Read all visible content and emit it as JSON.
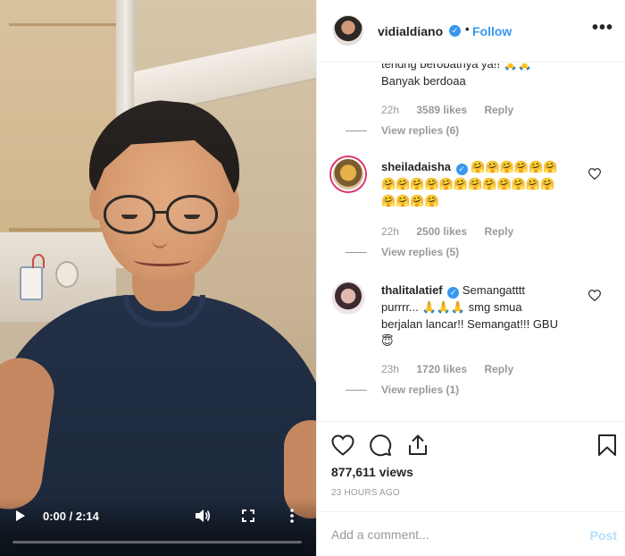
{
  "video": {
    "time": "0:00 / 2:14",
    "progress_fraction": 0.0
  },
  "header": {
    "username": "vidialdiano",
    "follow_label": "Follow",
    "dot": "•",
    "more": "•••"
  },
  "comments": [
    {
      "username": "",
      "text": "tendng berobatnya ya!! 🙏🙏 Banyak berdoaa",
      "time": "22h",
      "likes": "3589 likes",
      "reply": "Reply",
      "view_replies": "View replies (6)"
    },
    {
      "username": "sheiladaisha",
      "text": "🤗🤗🤗🤗🤗🤗🤗🤗🤗🤗🤗🤗🤗🤗🤗🤗🤗🤗🤗🤗🤗🤗",
      "time": "22h",
      "likes": "2500 likes",
      "reply": "Reply",
      "view_replies": "View replies (5)"
    },
    {
      "username": "thalitalatief",
      "text": "Semangatttt purrrr... 🙏🙏🙏 smg smua berjalan lancar!! Semangat!!! GBU😇",
      "time": "23h",
      "likes": "1720 likes",
      "reply": "Reply",
      "view_replies": "View replies (1)"
    }
  ],
  "actions": {
    "views": "877,611 views",
    "ago": "23 HOURS AGO"
  },
  "add_comment": {
    "placeholder": "Add a comment...",
    "post_label": "Post"
  },
  "colors": {
    "accent": "#3897f0",
    "post_disabled": "#b2dffc",
    "muted": "#999999"
  },
  "icons": [
    "play-icon",
    "volume-icon",
    "fullscreen-icon",
    "more-vertical-icon",
    "verified-icon",
    "more-horizontal-icon",
    "heart-icon",
    "comment-icon",
    "share-icon",
    "bookmark-icon"
  ]
}
